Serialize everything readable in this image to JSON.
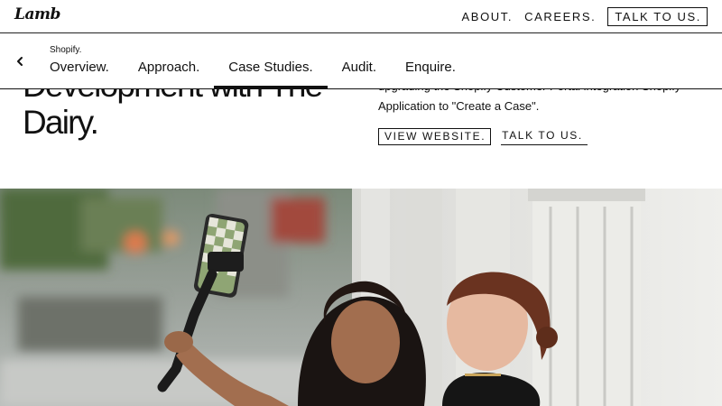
{
  "header": {
    "logo": "Lamb",
    "nav": [
      {
        "label": "ABOUT."
      },
      {
        "label": "CAREERS."
      },
      {
        "label": "TALK TO US."
      }
    ]
  },
  "subnav": {
    "breadcrumb": "Shopify.",
    "tabs": [
      {
        "label": "Overview."
      },
      {
        "label": "Approach."
      },
      {
        "label": "Case Studies.",
        "active": true
      },
      {
        "label": "Audit."
      },
      {
        "label": "Enquire."
      }
    ]
  },
  "hero": {
    "headline_line1": "Development with The",
    "headline_line2": "Dairy.",
    "description_line1": "upgrading the Shopify Customer Portal integration Shopify",
    "description_line2": "Application to \"Create a Case\".",
    "view_website": "VIEW WEBSITE.",
    "talk_to_us": "TALK TO US."
  },
  "photo": {
    "icon": "photo-two-women-selfie"
  }
}
